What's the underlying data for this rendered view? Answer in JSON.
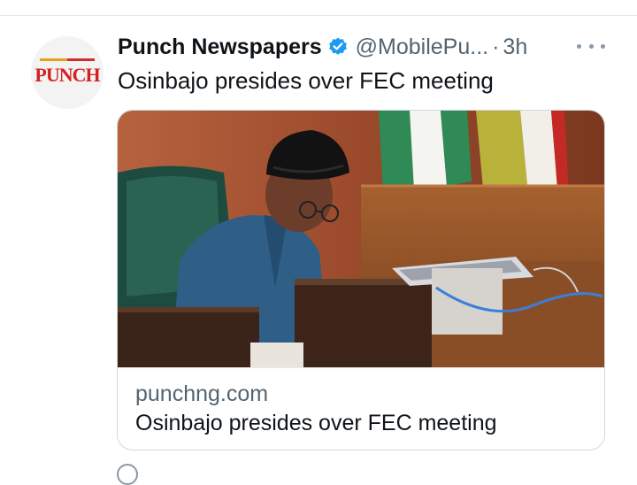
{
  "tweet": {
    "avatar": {
      "logo_text": "PUNCH",
      "icon": "punch-logo-avatar"
    },
    "display_name": "Punch Newspapers",
    "verified_icon": "verified-badge-icon",
    "handle": "@MobilePu...",
    "separator": "·",
    "time": "3h",
    "more_icon": "more-options-icon",
    "text": "Osinbajo presides over FEC meeting",
    "card": {
      "image_description": "photo",
      "domain": "punchng.com",
      "title": "Osinbajo presides over FEC meeting"
    }
  },
  "colors": {
    "text_primary": "#0f1419",
    "text_secondary": "#536471",
    "verified": "#1d9bf0",
    "punch_red": "#d42020",
    "border": "#cfd9de"
  }
}
